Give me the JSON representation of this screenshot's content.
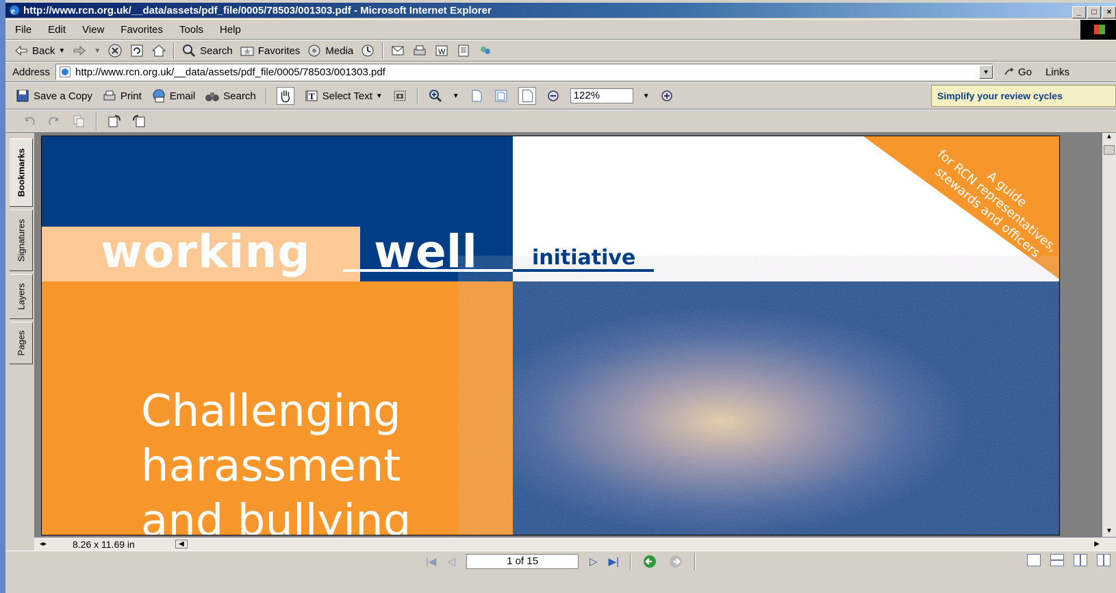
{
  "window": {
    "title": "http://www.rcn.org.uk/__data/assets/pdf_file/0005/78503/001303.pdf - Microsoft Internet Explorer",
    "controls": [
      "_",
      "□",
      "×"
    ]
  },
  "menu": [
    "File",
    "Edit",
    "View",
    "Favorites",
    "Tools",
    "Help"
  ],
  "ie_toolbar": {
    "back": "Back",
    "search": "Search",
    "favorites": "Favorites",
    "media": "Media"
  },
  "address": {
    "label": "Address",
    "url": "http://www.rcn.org.uk/__data/assets/pdf_file/0005/78503/001303.pdf",
    "go": "Go",
    "links": "Links"
  },
  "acrobat_toolbar": {
    "save_copy": "Save a Copy",
    "print": "Print",
    "email": "Email",
    "search": "Search",
    "select_text": "Select Text",
    "zoom": "122%",
    "promo": "Simplify your review cycles"
  },
  "nav_tabs": [
    "Bookmarks",
    "Signatures",
    "Layers",
    "Pages"
  ],
  "document": {
    "word1": "working",
    "word2": "well",
    "word3": "initiative",
    "corner_line1": "A guide",
    "corner_line2": "for RCN representatives,",
    "corner_line3": "stewards and officers",
    "title_line1": "Challenging",
    "title_line2": "harassment",
    "title_line3": "and bullying",
    "colors": {
      "navy": "#003d87",
      "orange": "#f7962a",
      "peach": "#fcc894"
    }
  },
  "page_size": "8.26 x 11.69 in",
  "pager": {
    "label": "1 of 15"
  }
}
